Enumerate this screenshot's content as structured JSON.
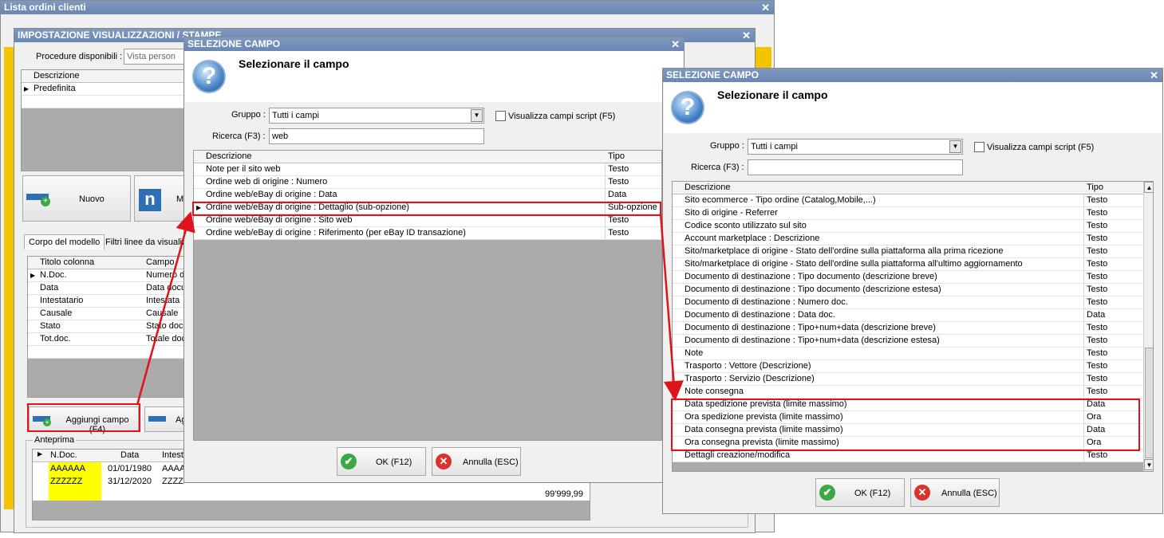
{
  "win1": {
    "title": "Lista ordini clienti"
  },
  "win2": {
    "title": "IMPOSTAZIONE VISUALIZZAZIONI / STAMPE",
    "procedure_label": "Procedure disponibili :",
    "procedure_value": "Vista person",
    "grid_header": "Descrizione",
    "grid_rows": [
      "Predefinita"
    ],
    "btn_nuovo": "Nuovo",
    "btn_m": "M",
    "tab1": "Corpo del modello",
    "tab2": "Filtri linee da visualiz",
    "cols_header": [
      "Titolo colonna",
      "Campo"
    ],
    "cols_rows": [
      [
        "N.Doc.",
        "Numero d"
      ],
      [
        "Data",
        "Data docu"
      ],
      [
        "Intestatario",
        "Intestata"
      ],
      [
        "Causale",
        "Causale"
      ],
      [
        "Stato",
        "Stato doc"
      ],
      [
        "Tot.doc.",
        "Totale doc"
      ]
    ],
    "btn_aggiungi": "Aggiungi campo (F4)",
    "btn_ag2": "Ag",
    "anteprima_label": "Anteprima",
    "preview_header": [
      "N.Doc.",
      "Data",
      "Intest"
    ],
    "preview_rows": [
      [
        "AAAAAA",
        "01/01/1980",
        "AAAA"
      ],
      [
        "ZZZZZZ",
        "31/12/2020",
        "ZZZZ"
      ]
    ],
    "preview_total": "99'999,99"
  },
  "dlg1": {
    "title": "SELEZIONE CAMPO",
    "heading": "Selezionare il campo",
    "gruppo_label": "Gruppo :",
    "gruppo_value": "Tutti i campi",
    "script_label": "Visualizza campi script (F5)",
    "ricerca_label": "Ricerca (F3) :",
    "ricerca_value": "web",
    "col_desc": "Descrizione",
    "col_tipo": "Tipo",
    "rows": [
      {
        "d": "Note per il sito web",
        "t": "Testo"
      },
      {
        "d": "Ordine web di origine : Numero",
        "t": "Testo"
      },
      {
        "d": "Ordine web/eBay di origine : Data",
        "t": "Data"
      },
      {
        "d": "Ordine web/eBay di origine : Dettaglio (sub-opzione)",
        "t": "Sub-opzione"
      },
      {
        "d": "Ordine web/eBay di origine : Sito web",
        "t": "Testo"
      },
      {
        "d": "Ordine web/eBay di origine : Riferimento (per eBay ID transazione)",
        "t": "Testo"
      }
    ],
    "ok": "OK (F12)",
    "annulla": "Annulla (ESC)"
  },
  "dlg2": {
    "title": "SELEZIONE CAMPO",
    "heading": "Selezionare il campo",
    "gruppo_label": "Gruppo :",
    "gruppo_value": "Tutti i campi",
    "script_label": "Visualizza campi script (F5)",
    "ricerca_label": "Ricerca (F3) :",
    "ricerca_value": "",
    "col_desc": "Descrizione",
    "col_tipo": "Tipo",
    "rows": [
      {
        "d": "Sito ecommerce - Tipo ordine (Catalog,Mobile,...)",
        "t": "Testo"
      },
      {
        "d": "Sito di origine - Referrer",
        "t": "Testo"
      },
      {
        "d": "Codice sconto utilizzato sul sito",
        "t": "Testo"
      },
      {
        "d": "Account marketplace : Descrizione",
        "t": "Testo"
      },
      {
        "d": "Sito/marketplace di origine - Stato dell'ordine sulla piattaforma alla prima ricezione",
        "t": "Testo"
      },
      {
        "d": "Sito/marketplace di origine - Stato dell'ordine sulla piattaforma all'ultimo aggiornamento",
        "t": "Testo"
      },
      {
        "d": "Documento di destinazione : Tipo documento (descrizione breve)",
        "t": "Testo"
      },
      {
        "d": "Documento di destinazione : Tipo documento (descrizione estesa)",
        "t": "Testo"
      },
      {
        "d": "Documento di destinazione : Numero doc.",
        "t": "Testo"
      },
      {
        "d": "Documento di destinazione : Data doc.",
        "t": "Data"
      },
      {
        "d": "Documento di destinazione : Tipo+num+data (descrizione breve)",
        "t": "Testo"
      },
      {
        "d": "Documento di destinazione : Tipo+num+data (descrizione estesa)",
        "t": "Testo"
      },
      {
        "d": "Note",
        "t": "Testo"
      },
      {
        "d": "Trasporto : Vettore (Descrizione)",
        "t": "Testo"
      },
      {
        "d": "Trasporto : Servizio (Descrizione)",
        "t": "Testo"
      },
      {
        "d": "Note consegna",
        "t": "Testo"
      },
      {
        "d": "Data spedizione prevista (limite massimo)",
        "t": "Data"
      },
      {
        "d": "Ora spedizione prevista (limite massimo)",
        "t": "Ora"
      },
      {
        "d": "Data consegna prevista (limite massimo)",
        "t": "Data"
      },
      {
        "d": "Ora consegna prevista (limite massimo)",
        "t": "Ora"
      },
      {
        "d": "Dettagli creazione/modifica",
        "t": "Testo"
      }
    ],
    "ok": "OK (F12)",
    "annulla": "Annulla (ESC)"
  },
  "colors": {
    "highlight": "#e0131b",
    "title_bar": "#7088b8",
    "preview_yellow": "#ffff00",
    "frame_yellow": "#f5c400"
  }
}
